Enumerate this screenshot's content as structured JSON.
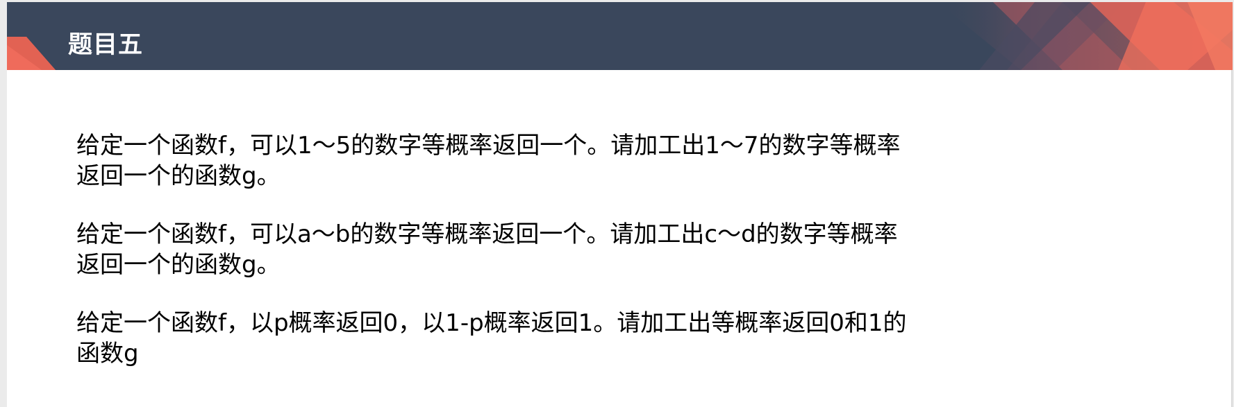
{
  "slide": {
    "title": "题目五",
    "colors": {
      "header_bar": "#3a475c",
      "accent_coral": "#ef6b5b",
      "text": "#000000",
      "background": "#ffffff"
    }
  },
  "problems": [
    {
      "lines": [
        "给定一个函数f，可以1～5的数字等概率返回一个。请加工出1～7的数字等概率",
        "返回一个的函数g。"
      ]
    },
    {
      "lines": [
        "给定一个函数f，可以a～b的数字等概率返回一个。请加工出c～d的数字等概率",
        "返回一个的函数g。"
      ]
    },
    {
      "lines": [
        "给定一个函数f，以p概率返回0，以1-p概率返回1。请加工出等概率返回0和1的",
        "函数g"
      ]
    }
  ]
}
